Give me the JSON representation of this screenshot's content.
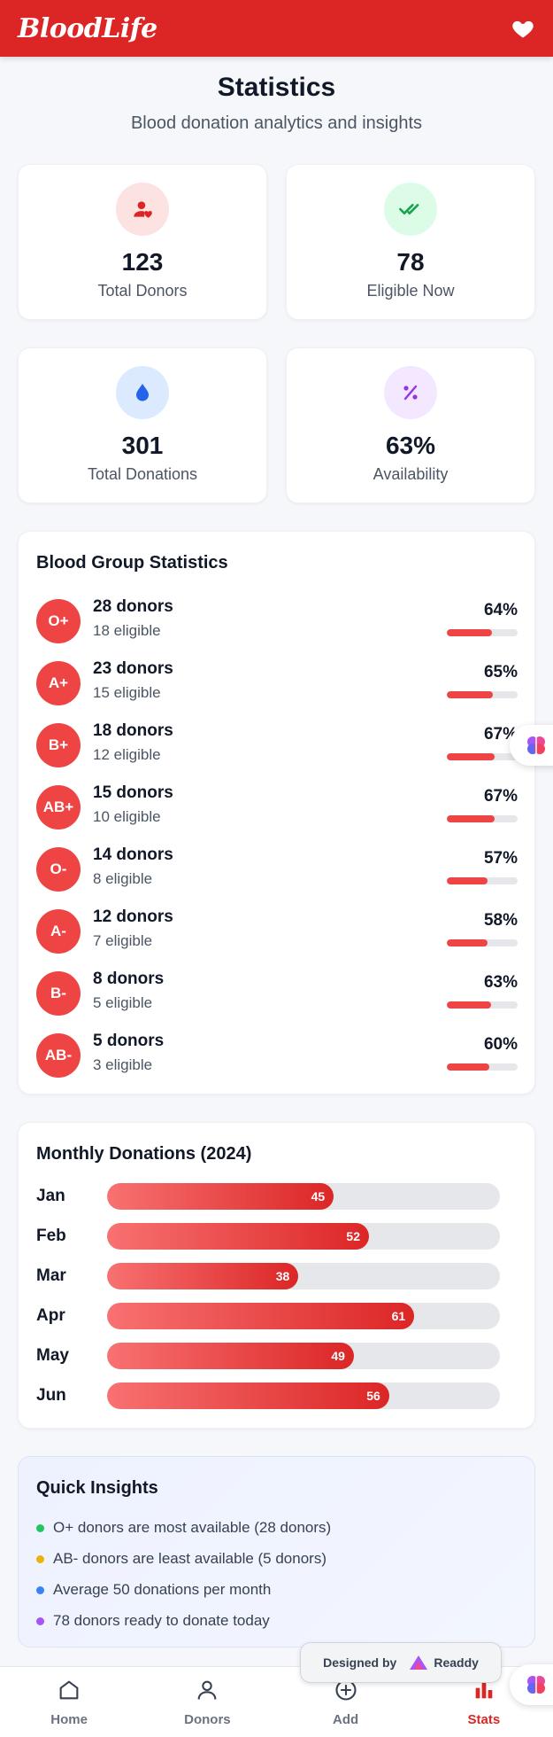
{
  "header": {
    "brand": "BloodLife"
  },
  "page": {
    "title": "Statistics",
    "subtitle": "Blood donation analytics and insights"
  },
  "stats": [
    {
      "value": "123",
      "label": "Total Donors",
      "icon": "user-heart-icon",
      "bg": "#fde2e2",
      "color": "#dc2626"
    },
    {
      "value": "78",
      "label": "Eligible Now",
      "icon": "double-check-icon",
      "bg": "#dcfce7",
      "color": "#16a34a"
    },
    {
      "value": "301",
      "label": "Total Donations",
      "icon": "drop-icon",
      "bg": "#dbeafe",
      "color": "#2563eb"
    },
    {
      "value": "63%",
      "label": "Availability",
      "icon": "percent-icon",
      "bg": "#f3e8ff",
      "color": "#9333ea"
    }
  ],
  "blood_groups": {
    "title": "Blood Group Statistics",
    "items": [
      {
        "group": "O+",
        "donors": "28 donors",
        "eligible": "18 eligible",
        "percent_label": "64%",
        "percent": 64
      },
      {
        "group": "A+",
        "donors": "23 donors",
        "eligible": "15 eligible",
        "percent_label": "65%",
        "percent": 65
      },
      {
        "group": "B+",
        "donors": "18 donors",
        "eligible": "12 eligible",
        "percent_label": "67%",
        "percent": 67
      },
      {
        "group": "AB+",
        "donors": "15 donors",
        "eligible": "10 eligible",
        "percent_label": "67%",
        "percent": 67
      },
      {
        "group": "O-",
        "donors": "14 donors",
        "eligible": "8 eligible",
        "percent_label": "57%",
        "percent": 57
      },
      {
        "group": "A-",
        "donors": "12 donors",
        "eligible": "7 eligible",
        "percent_label": "58%",
        "percent": 58
      },
      {
        "group": "B-",
        "donors": "8 donors",
        "eligible": "5 eligible",
        "percent_label": "63%",
        "percent": 63
      },
      {
        "group": "AB-",
        "donors": "5 donors",
        "eligible": "3 eligible",
        "percent_label": "60%",
        "percent": 60
      }
    ]
  },
  "monthly": {
    "title": "Monthly Donations (2024)",
    "items": [
      {
        "month": "Jan",
        "value": 45,
        "label": "45"
      },
      {
        "month": "Feb",
        "value": 52,
        "label": "52"
      },
      {
        "month": "Mar",
        "value": 38,
        "label": "38"
      },
      {
        "month": "Apr",
        "value": 61,
        "label": "61"
      },
      {
        "month": "May",
        "value": 49,
        "label": "49"
      },
      {
        "month": "Jun",
        "value": 56,
        "label": "56"
      }
    ],
    "max": 78
  },
  "insights": {
    "title": "Quick Insights",
    "items": [
      {
        "text": "O+ donors are most available (28 donors)",
        "color": "#22c55e"
      },
      {
        "text": "AB- donors are least available (5 donors)",
        "color": "#eab308"
      },
      {
        "text": "Average 50 donations per month",
        "color": "#3b82f6"
      },
      {
        "text": "78 donors ready to donate today",
        "color": "#a855f7"
      }
    ]
  },
  "designed_by": {
    "prefix": "Designed by",
    "name": "Readdy"
  },
  "nav": [
    {
      "label": "Home",
      "icon": "home-icon",
      "active": false
    },
    {
      "label": "Donors",
      "icon": "user-icon",
      "active": false
    },
    {
      "label": "Add",
      "icon": "plus-circle-icon",
      "active": false
    },
    {
      "label": "Stats",
      "icon": "bar-chart-icon",
      "active": true
    }
  ],
  "colors": {
    "primary": "#dc2626",
    "accent": "#ef4444"
  }
}
